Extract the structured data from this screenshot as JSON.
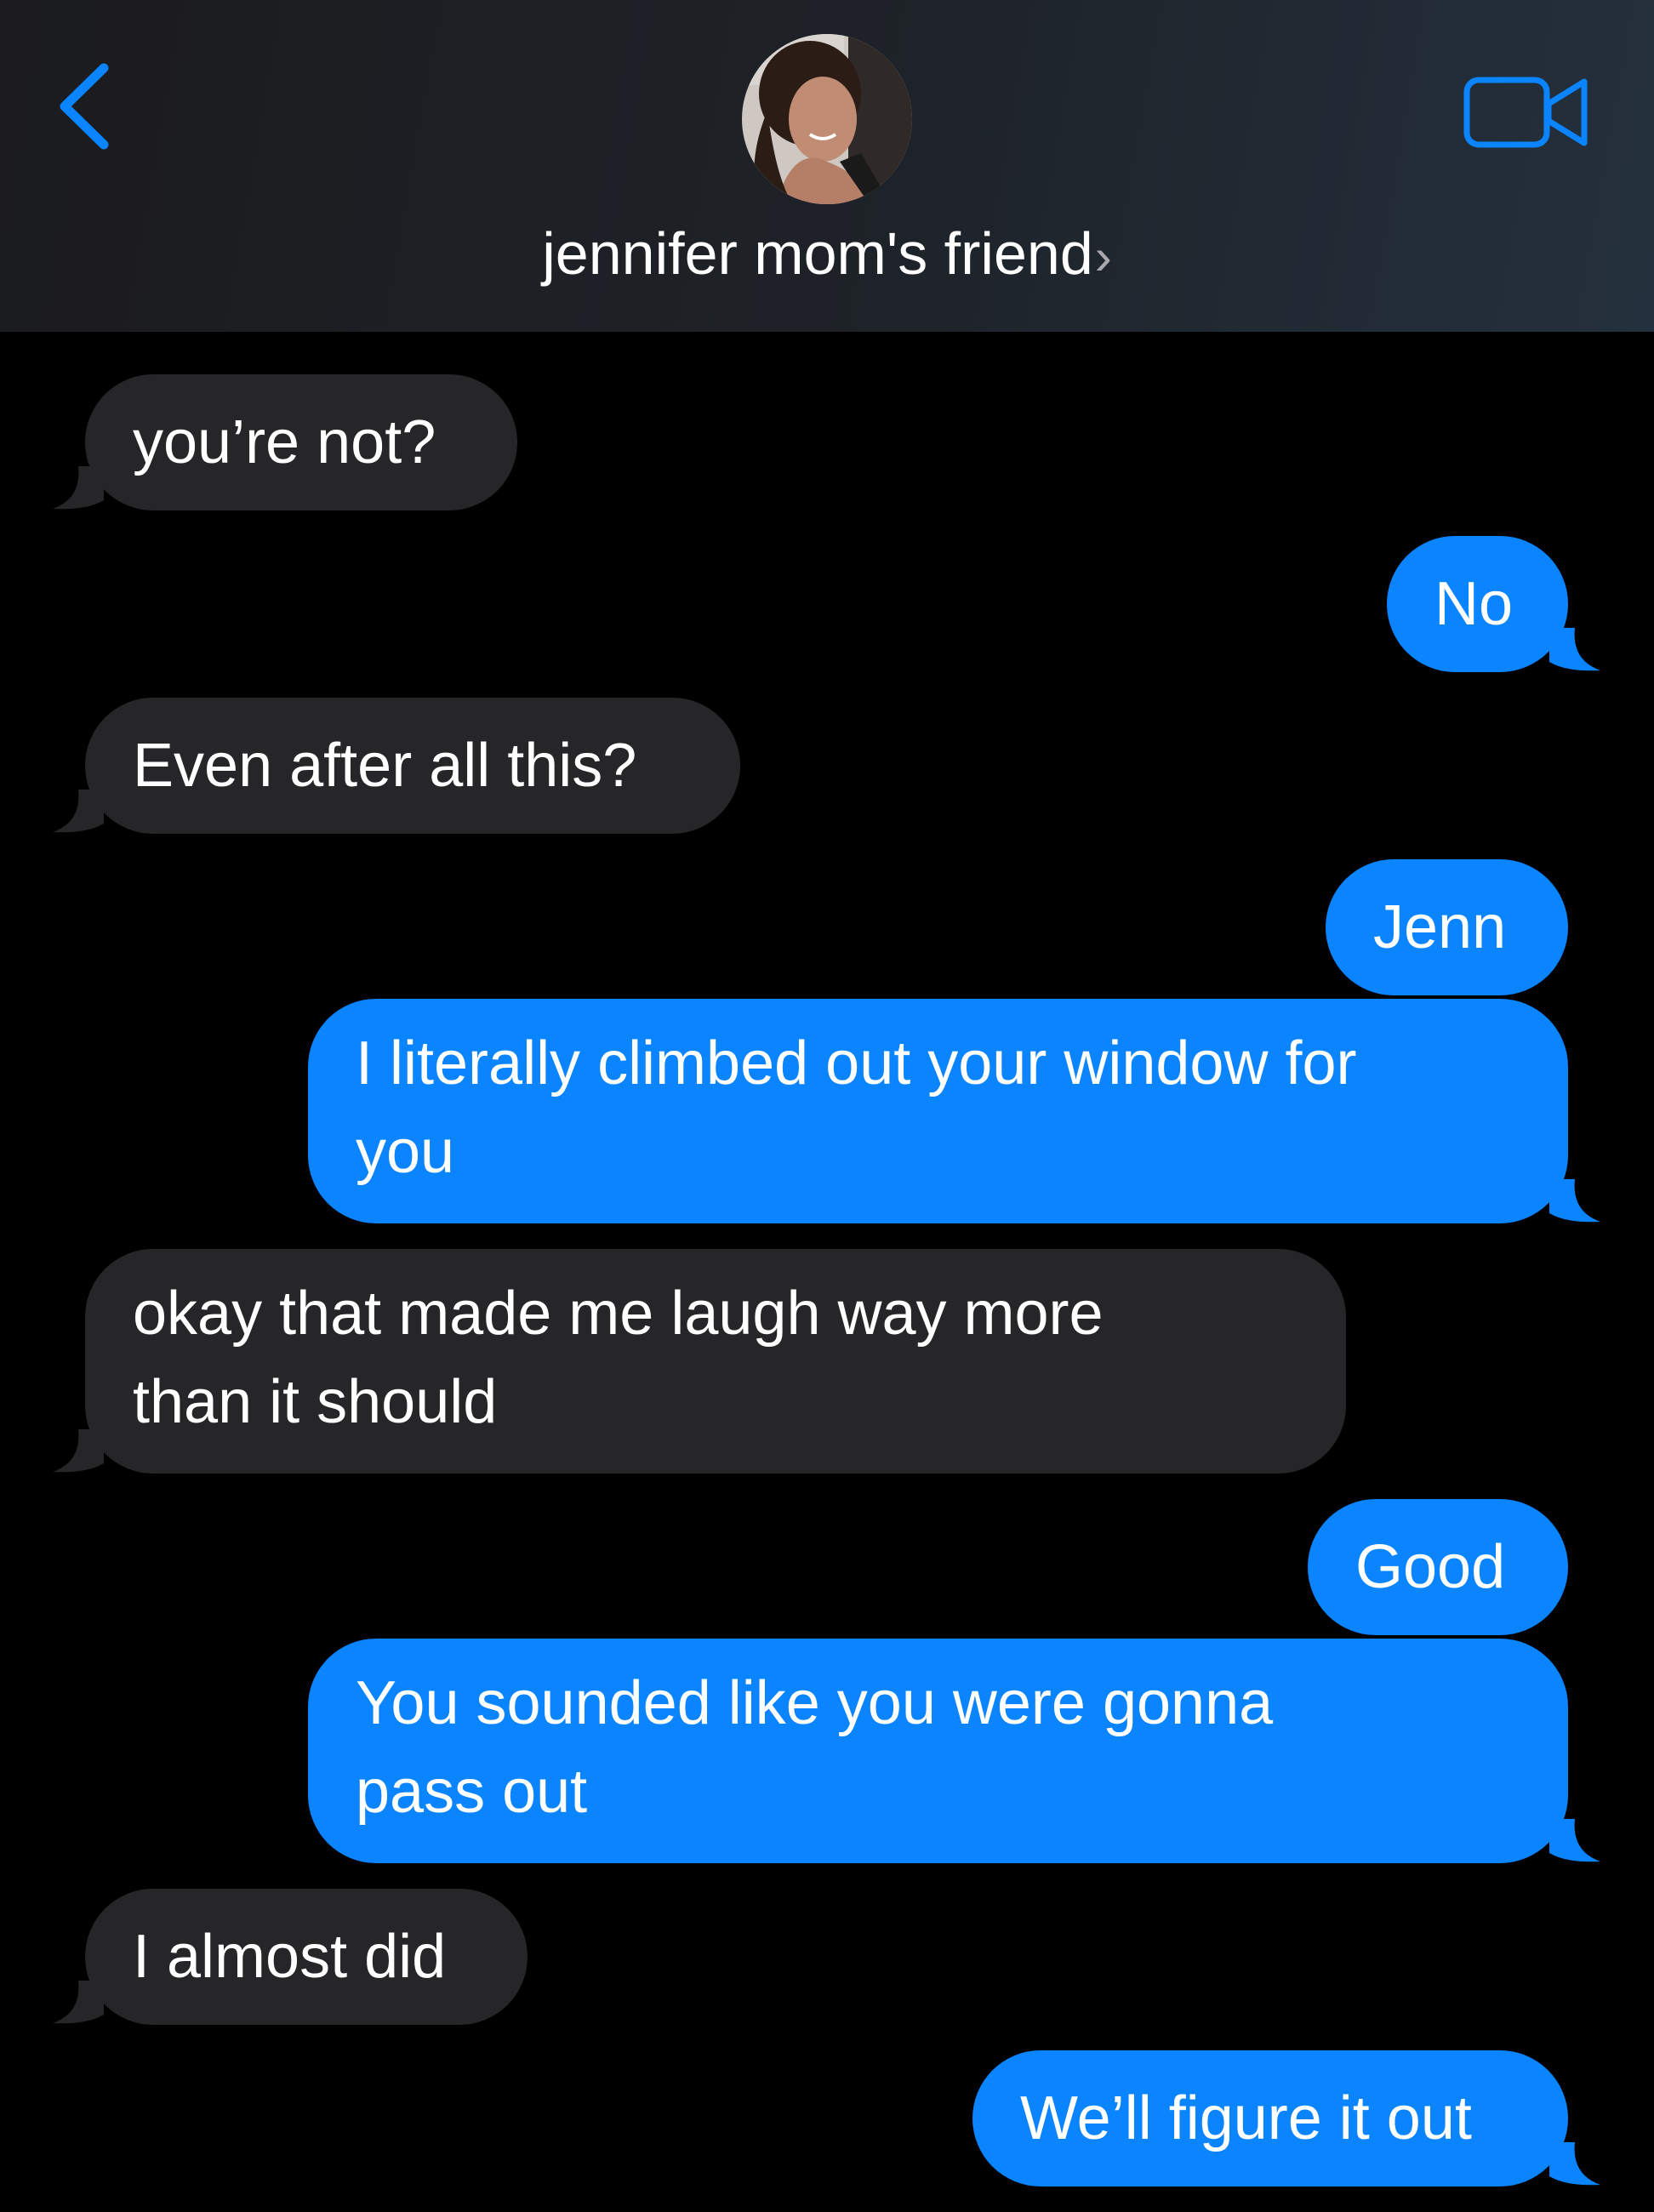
{
  "header": {
    "back_icon": "chevron-left-icon",
    "contact_name": "jennifer mom's friend",
    "name_chevron": "›",
    "video_icon": "video-camera-icon",
    "accent_color": "#0a84ff"
  },
  "colors": {
    "incoming_bubble": "#262629",
    "outgoing_bubble": "#0a84ff",
    "background": "#000000"
  },
  "messages": [
    {
      "direction": "incoming",
      "lines": [
        "you’re not?"
      ]
    },
    {
      "direction": "outgoing",
      "lines": [
        "No"
      ]
    },
    {
      "direction": "incoming",
      "lines": [
        "Even after all this?"
      ]
    },
    {
      "direction": "outgoing",
      "lines": [
        "Jenn"
      ]
    },
    {
      "direction": "outgoing",
      "lines": [
        "I literally climbed out your window for",
        "you"
      ]
    },
    {
      "direction": "incoming",
      "lines": [
        "okay that made me laugh way more",
        "than it should"
      ]
    },
    {
      "direction": "outgoing",
      "lines": [
        "Good"
      ]
    },
    {
      "direction": "outgoing",
      "lines": [
        "You sounded like you were gonna",
        "pass out"
      ]
    },
    {
      "direction": "incoming",
      "lines": [
        "I almost did"
      ]
    },
    {
      "direction": "outgoing",
      "lines": [
        "We’ll figure it out"
      ]
    }
  ]
}
